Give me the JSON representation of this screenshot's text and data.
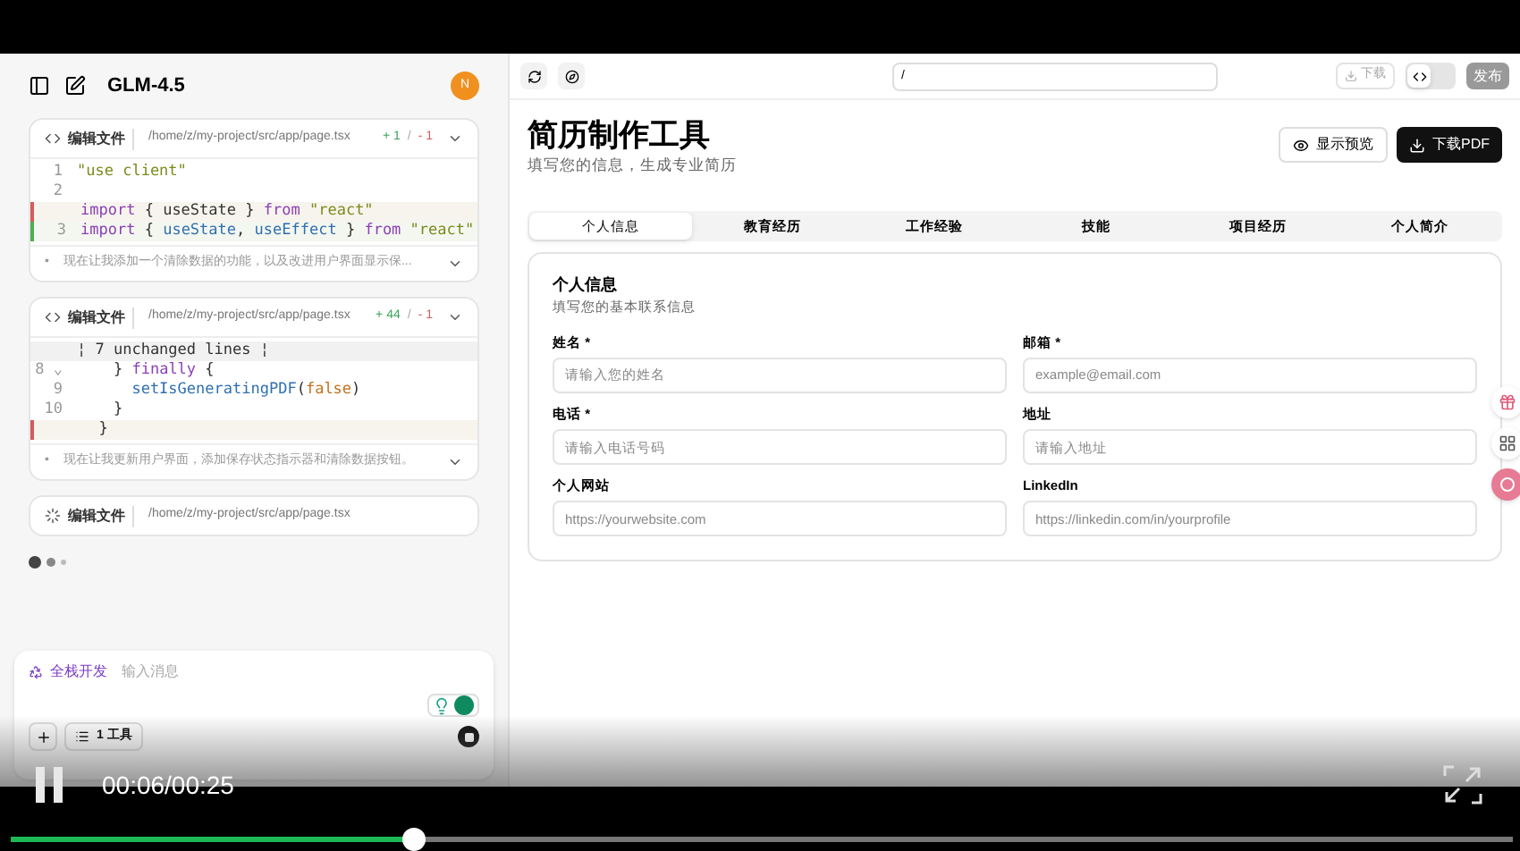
{
  "video": {
    "playing": true,
    "time": "00:06/00:25",
    "level": 0.268
  },
  "sidebar": {
    "title": "GLM-4.5",
    "avatar": "N",
    "edits": [
      {
        "running": false,
        "label": "编辑文件",
        "path": "/home/z/my-project/src/app/page.tsx",
        "added": "+ 1",
        "sep": "/",
        "removed": "- 1",
        "bullet": "•",
        "lines": [
          {
            "kind": "normal",
            "num": "1",
            "tokens": [
              {
                "kind": "str",
                "t": "\"use client\""
              }
            ]
          },
          {
            "kind": "normal",
            "num": "2"
          },
          {
            "kind": "removed",
            "tokens": [
              {
                "kind": "kw",
                "t": "import"
              },
              {
                "kind": "plain",
                "t": " { useState } "
              },
              {
                "kind": "kw",
                "t": "from"
              },
              {
                "kind": "str",
                "t": " \"react\""
              }
            ]
          },
          {
            "kind": "added",
            "num": "3",
            "tokens": [
              {
                "kind": "kw",
                "t": "import"
              },
              {
                "kind": "plain",
                "t": " { "
              },
              {
                "kind": "fn",
                "t": "useState"
              },
              {
                "kind": "plain",
                "t": ", "
              },
              {
                "kind": "fn",
                "t": "useEffect"
              },
              {
                "kind": "plain",
                "t": " } "
              },
              {
                "kind": "kw",
                "t": "from"
              },
              {
                "kind": "str",
                "t": " \"react\""
              }
            ]
          }
        ],
        "note": "现在让我添加一个清除数据的功能，以及改进用户界面显示保..."
      },
      {
        "running": false,
        "label": "编辑文件",
        "path": "/home/z/my-project/src/app/page.tsx",
        "added": "+ 44",
        "sep": "/",
        "removed": "- 1",
        "bullet": "•",
        "lines": [
          {
            "kind": "collapsed",
            "tokens": [
              {
                "kind": "plain",
                "t": "¦ 7 unchanged lines ¦"
              }
            ]
          },
          {
            "kind": "normal",
            "num": "8 ⌄",
            "tokens": [
              {
                "kind": "plain",
                "t": "    } "
              },
              {
                "kind": "kw",
                "t": "finally"
              },
              {
                "kind": "plain",
                "t": " {"
              }
            ]
          },
          {
            "kind": "normal",
            "num": "9",
            "tokens": [
              {
                "kind": "fn",
                "t": "      setIsGeneratingPDF"
              },
              {
                "kind": "plain",
                "t": "("
              },
              {
                "kind": "lit",
                "t": "false"
              },
              {
                "kind": "plain",
                "t": ")"
              }
            ]
          },
          {
            "kind": "normal",
            "num": "10",
            "tokens": [
              {
                "kind": "plain",
                "t": "    }"
              }
            ]
          },
          {
            "kind": "removed",
            "tokens": [
              {
                "kind": "plain",
                "t": "  }"
              }
            ]
          }
        ],
        "note": "现在让我更新用户界面，添加保存状态指示器和清除数据按钮。"
      },
      {
        "running": true,
        "label": "编辑文件",
        "path": "/home/z/my-project/src/app/page.tsx"
      }
    ],
    "composer": {
      "mode": "全栈开发",
      "placeholder": "输入消息",
      "tools": "1 工具"
    }
  },
  "toolbar": {
    "url": "/",
    "download": "下载",
    "code_view": true,
    "publish": "发布"
  },
  "page": {
    "title": "简历制作工具",
    "subtitle": "填写您的信息，生成专业简历",
    "preview": "显示预览",
    "download": "下载PDF",
    "tabs": [
      {
        "label": "个人信息",
        "selected": true
      },
      {
        "label": "教育经历",
        "selected": false
      },
      {
        "label": "工作经验",
        "selected": false
      },
      {
        "label": "技能",
        "selected": false
      },
      {
        "label": "项目经历",
        "selected": false
      },
      {
        "label": "个人简介",
        "selected": false
      }
    ],
    "section": {
      "title": "个人信息",
      "subtitle": "填写您的基本联系信息",
      "fields": [
        {
          "label": "姓名 *",
          "placeholder": "请输入您的姓名"
        },
        {
          "label": "邮箱 *",
          "placeholder": "example@email.com"
        },
        {
          "label": "电话 *",
          "placeholder": "请输入电话号码"
        },
        {
          "label": "地址",
          "placeholder": "请输入地址"
        },
        {
          "label": "个人网站",
          "placeholder": "https://yourwebsite.com"
        },
        {
          "label": "LinkedIn",
          "placeholder": "https://linkedin.com/in/yourprofile"
        }
      ]
    }
  }
}
